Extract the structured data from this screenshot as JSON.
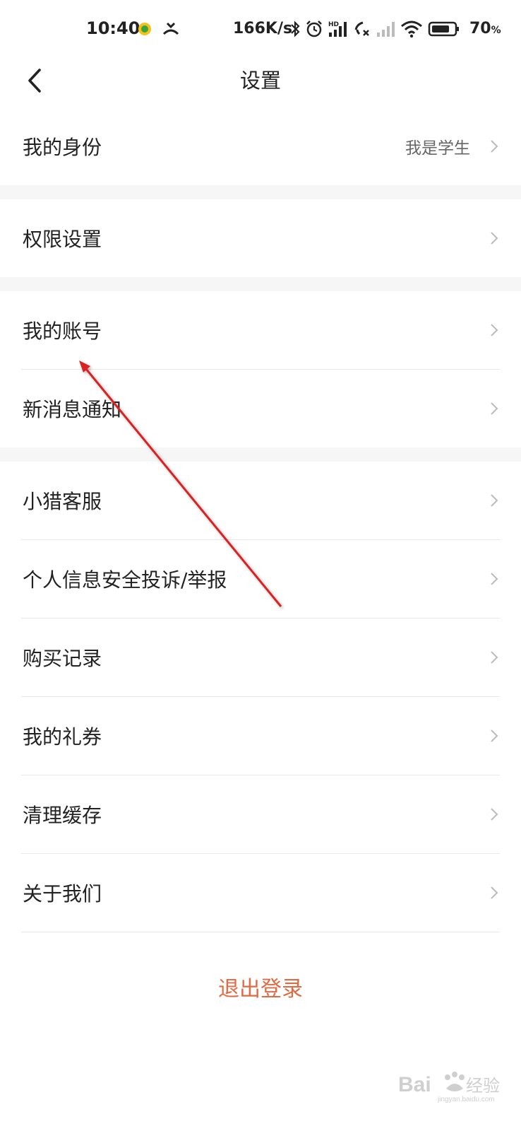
{
  "status_bar": {
    "time": "10:40",
    "net_speed": "166K/s",
    "battery_pct": "70",
    "battery_unit": "%",
    "hd_label": "HD"
  },
  "nav": {
    "title": "设置"
  },
  "rows": {
    "identity": {
      "label": "我的身份",
      "value": "我是学生"
    },
    "permissions": {
      "label": "权限设置"
    },
    "account": {
      "label": "我的账号"
    },
    "notify": {
      "label": "新消息通知"
    },
    "service": {
      "label": "小猎客服"
    },
    "complaint": {
      "label": "个人信息安全投诉/举报"
    },
    "purchase": {
      "label": "购买记录"
    },
    "coupons": {
      "label": "我的礼券"
    },
    "cache": {
      "label": "清理缓存"
    },
    "about": {
      "label": "关于我们"
    }
  },
  "logout_label": "退出登录",
  "colors": {
    "accent": "#e26a43",
    "arrow": "#d92323",
    "gap_bg": "#f6f6f6",
    "divider": "#e8e8e8"
  },
  "icons": {
    "back": "chevron-left-icon",
    "row": "chevron-right-icon"
  }
}
